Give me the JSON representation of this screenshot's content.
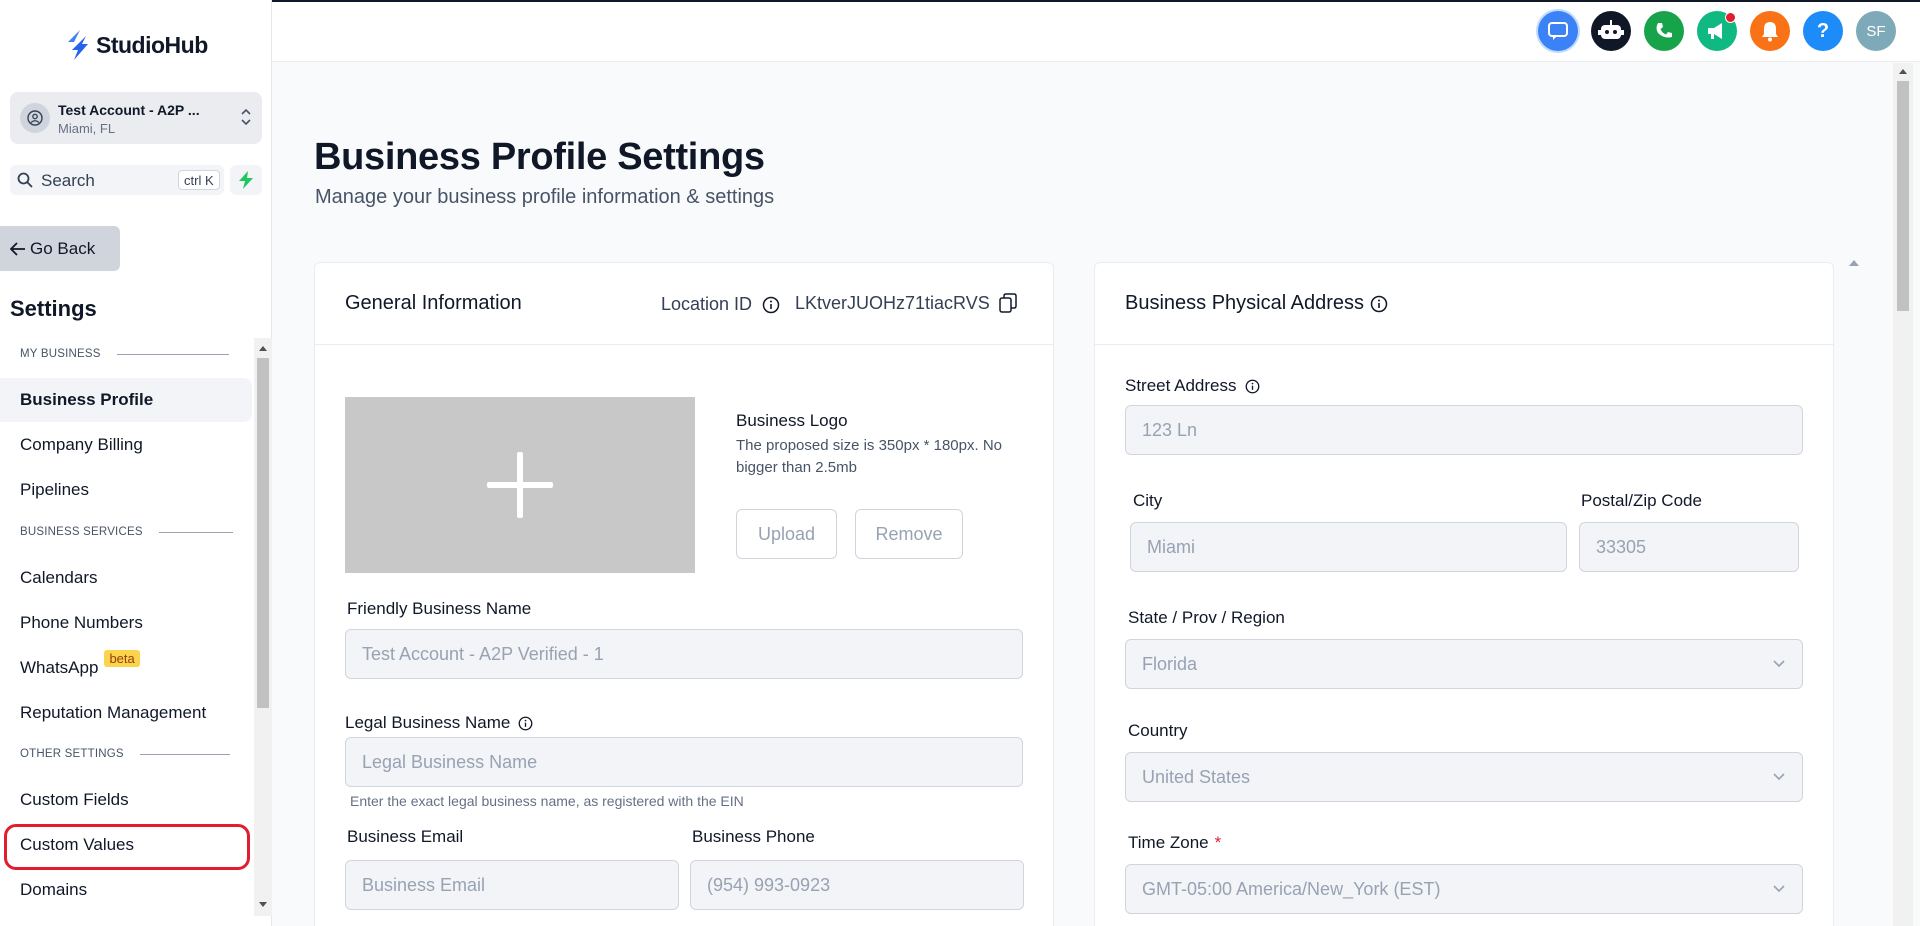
{
  "app": {
    "name": "StudioHub"
  },
  "account": {
    "name": "Test Account - A2P ...",
    "location": "Miami, FL"
  },
  "search": {
    "label": "Search",
    "shortcut": "ctrl K"
  },
  "sidebar": {
    "go_back": "Go Back",
    "title": "Settings",
    "sections": {
      "my_business": "MY BUSINESS",
      "business_services": "BUSINESS SERVICES",
      "other_settings": "OTHER SETTINGS"
    },
    "items": {
      "business_profile": "Business Profile",
      "company_billing": "Company Billing",
      "pipelines": "Pipelines",
      "calendars": "Calendars",
      "phone_numbers": "Phone Numbers",
      "whatsapp": "WhatsApp",
      "whatsapp_badge": "beta",
      "reputation": "Reputation Management",
      "custom_fields": "Custom Fields",
      "custom_values": "Custom Values",
      "domains": "Domains"
    },
    "active": "business_profile"
  },
  "topbar": {
    "icons": [
      "chat-icon",
      "bot-icon",
      "phone-icon",
      "megaphone-icon",
      "bell-icon",
      "help-icon",
      "user-avatar"
    ],
    "avatar_initials": "SF",
    "colors": {
      "chat": "#3b82f6",
      "bot": "#101828",
      "phone": "#16a34a",
      "megaphone": "#10b981",
      "bell": "#f97316",
      "help": "#1d8cf8",
      "avatar": "#7ea9b8"
    }
  },
  "page": {
    "title": "Business Profile Settings",
    "subtitle": "Manage your business profile information & settings"
  },
  "general": {
    "title": "General Information",
    "location_id_label": "Location ID",
    "location_id": "LKtverJUOHz71tiacRVS",
    "logo_title": "Business Logo",
    "logo_hint": "The proposed size is 350px * 180px. No bigger than 2.5mb",
    "upload": "Upload",
    "remove": "Remove",
    "friendly_name_label": "Friendly Business Name",
    "friendly_name_value": "Test Account - A2P Verified - 1",
    "legal_name_label": "Legal Business Name",
    "legal_name_placeholder": "Legal Business Name",
    "legal_name_hint": "Enter the exact legal business name, as registered with the EIN",
    "email_label": "Business Email",
    "email_placeholder": "Business Email",
    "phone_label": "Business Phone",
    "phone_value": "(954) 993-0923"
  },
  "address": {
    "title": "Business Physical Address",
    "street_label": "Street Address",
    "street_value": "123 Ln",
    "city_label": "City",
    "city_value": "Miami",
    "zip_label": "Postal/Zip Code",
    "zip_value": "33305",
    "state_label": "State / Prov / Region",
    "state_value": "Florida",
    "country_label": "Country",
    "country_value": "United States",
    "tz_label": "Time Zone",
    "tz_required": "*",
    "tz_value": "GMT-05:00 America/New_York (EST)"
  }
}
